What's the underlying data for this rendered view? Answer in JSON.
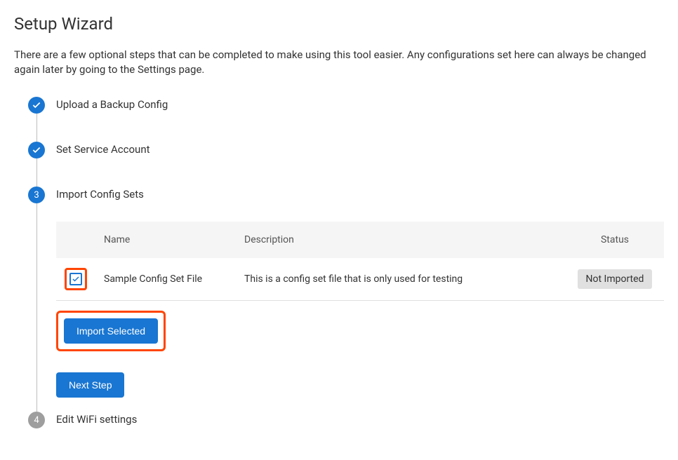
{
  "header": {
    "title": "Setup Wizard",
    "description": "There are a few optional steps that can be completed to make using this tool easier. Any configurations set here can always be changed again later by going to the Settings page."
  },
  "steps": [
    {
      "label": "Upload a Backup Config",
      "state": "done"
    },
    {
      "label": "Set Service Account",
      "state": "done"
    },
    {
      "label": "Import Config Sets",
      "state": "active",
      "number": "3"
    },
    {
      "label": "Edit WiFi settings",
      "state": "pending",
      "number": "4"
    }
  ],
  "config_table": {
    "headers": {
      "name": "Name",
      "description": "Description",
      "status": "Status"
    },
    "rows": [
      {
        "checked": true,
        "name": "Sample Config Set File",
        "description": "This is a config set file that is only used for testing",
        "status": "Not Imported"
      }
    ]
  },
  "buttons": {
    "import_selected": "Import Selected",
    "next_step": "Next Step"
  }
}
